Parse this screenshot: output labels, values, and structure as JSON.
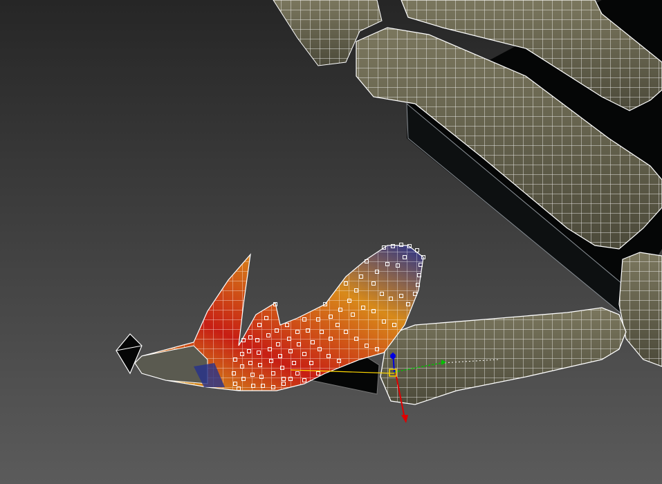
{
  "viewport": {
    "background_top": "#262626",
    "background_bottom": "#5b5b5b",
    "mesh_wire_color": "#ffffff",
    "bone_color": "#6e6a52",
    "bone_shadow_color": "#3a382c",
    "block_color": "#050606"
  },
  "weight_gradient": {
    "high": "#c71e14",
    "mid": "#d88a1a",
    "low": "#d9c21e",
    "zero": "#26318c"
  },
  "gizmo": {
    "x_axis_color": "#00c000",
    "y_axis_color": "#e00000",
    "z_axis_color": "#0000e0",
    "pivot_color": "#ffd800"
  },
  "helpers": {
    "pivot_marker_icon": "diamond-icon",
    "control_vertex_icon": "square-icon",
    "transform_gizmo_icon": "axis-tripod-icon"
  }
}
